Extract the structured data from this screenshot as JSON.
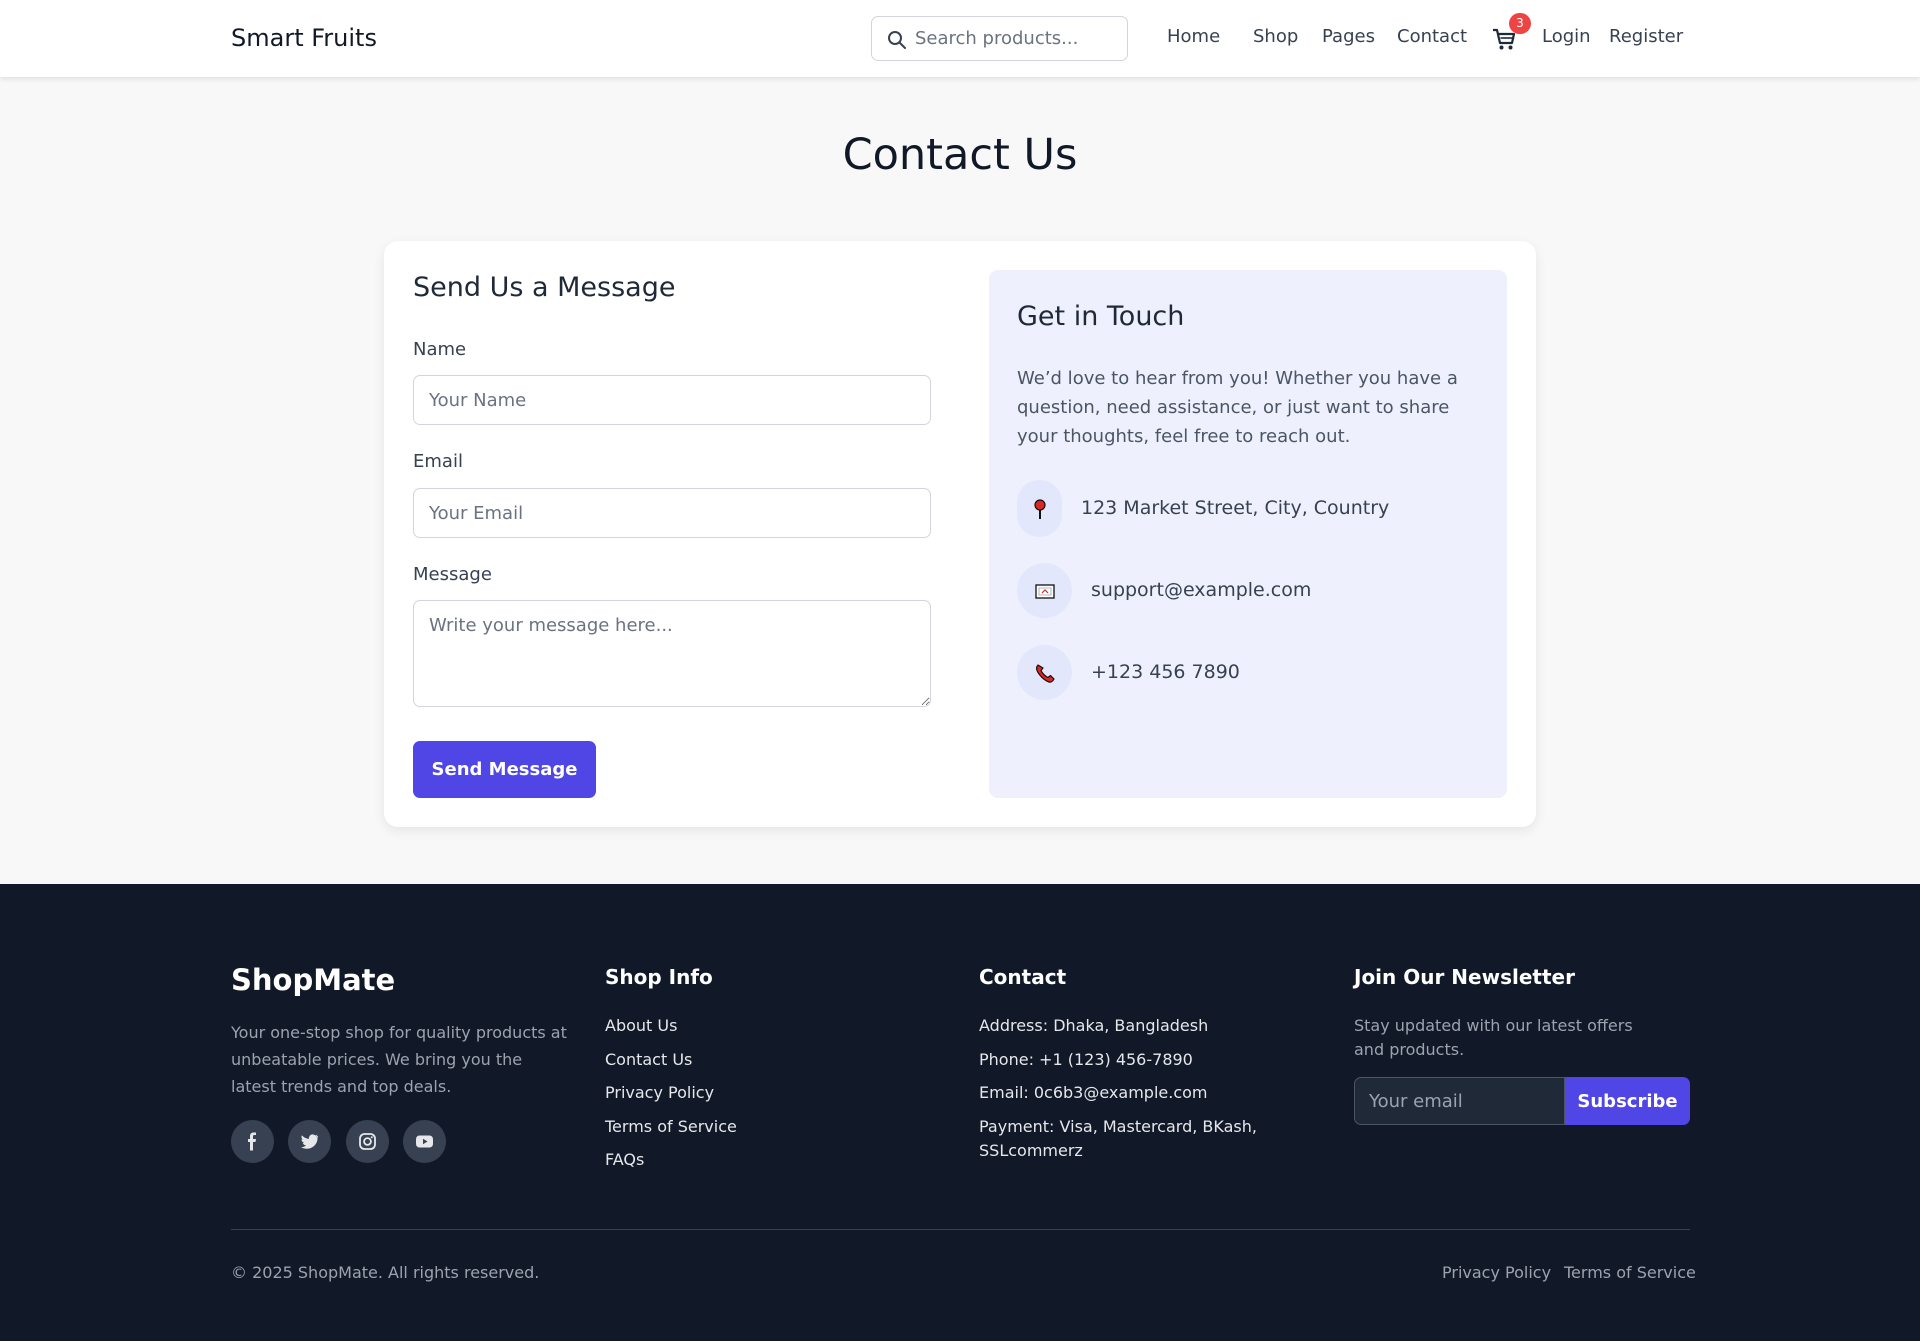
{
  "header": {
    "brand": "Smart Fruits",
    "search_placeholder": "Search products...",
    "nav": [
      "Home",
      "Shop",
      "Pages",
      "Contact"
    ],
    "cart_count": "3",
    "login": "Login",
    "register": "Register"
  },
  "page": {
    "title": "Contact Us"
  },
  "form": {
    "title": "Send Us a Message",
    "name_label": "Name",
    "name_placeholder": "Your Name",
    "email_label": "Email",
    "email_placeholder": "Your Email",
    "message_label": "Message",
    "message_placeholder": "Write your message here...",
    "submit_label": "Send Message"
  },
  "touch": {
    "title": "Get in Touch",
    "text": "We’d love to hear from you! Whether you have a question, need assistance, or just want to share your thoughts, feel free to reach out.",
    "address": "123 Market Street, City, Country",
    "email": "support@example.com",
    "phone": "+123 456 7890"
  },
  "footer": {
    "brand": "ShopMate",
    "description": "Your one-stop shop for quality products at unbeatable prices. We bring you the latest trends and top deals.",
    "social": [
      "facebook-icon",
      "twitter-icon",
      "instagram-icon",
      "youtube-icon"
    ],
    "shop_info_title": "Shop Info",
    "shop_links": [
      "About Us",
      "Contact Us",
      "Privacy Policy",
      "Terms of Service",
      "FAQs"
    ],
    "contact_title": "Contact",
    "contact_lines": [
      "Address: Dhaka, Bangladesh",
      "Phone: +1 (123) 456-7890",
      "Email: 0c6b3@example.com",
      "Payment: Visa, Mastercard, BKash, SSLcommerz"
    ],
    "newsletter_title": "Join Our Newsletter",
    "newsletter_text": "Stay updated with our latest offers and products.",
    "newsletter_placeholder": "Your email",
    "subscribe_label": "Subscribe",
    "copyright": "© 2025 ShopMate. All rights reserved.",
    "bottom_links": [
      "Privacy Policy",
      "Terms of Service"
    ]
  },
  "colors": {
    "accent": "#4f46e5",
    "footer_bg": "#111827",
    "badge": "#ef4444",
    "touch_bg": "#eef1fd"
  }
}
